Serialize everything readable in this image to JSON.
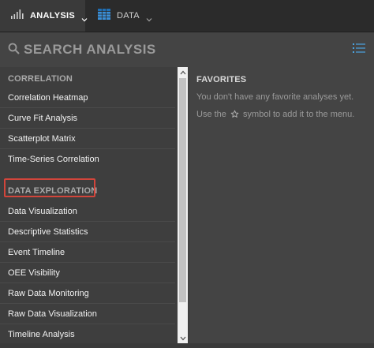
{
  "topbar": {
    "tabs": [
      {
        "label": "ANALYSIS",
        "icon": "bar-chart-icon",
        "active": true
      },
      {
        "label": "DATA",
        "icon": "table-grid-icon",
        "active": false
      }
    ]
  },
  "search": {
    "placeholder": "SEARCH ANALYSIS",
    "value": ""
  },
  "menu": {
    "correlation": {
      "title": "CORRELATION",
      "items": [
        "Correlation Heatmap",
        "Curve Fit Analysis",
        "Scatterplot Matrix",
        "Time-Series Correlation"
      ]
    },
    "exploration": {
      "title": "DATA EXPLORATION",
      "items": [
        "Data Visualization",
        "Descriptive Statistics",
        "Event Timeline",
        "OEE Visibility",
        "Raw Data Monitoring",
        "Raw Data Visualization",
        "Timeline Analysis"
      ]
    }
  },
  "favorites": {
    "title": "FAVORITES",
    "empty_message": "You don't have any favorite analyses yet.",
    "hint_before": "Use the",
    "hint_after": "symbol to add it to the menu."
  },
  "colors": {
    "highlight_border": "#d2453b",
    "table_icon": "#3a8fd8",
    "accent": "#4aa3e0"
  }
}
